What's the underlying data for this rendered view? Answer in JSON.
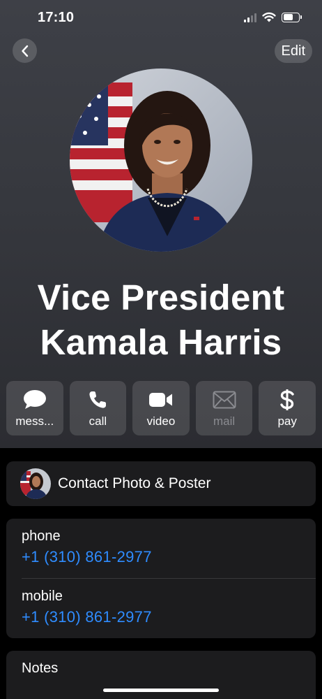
{
  "status_bar": {
    "time": "17:10",
    "battery_level": 0.65
  },
  "nav": {
    "back_icon": "chevron-left-icon",
    "edit_label": "Edit"
  },
  "contact": {
    "name_line1": "Vice President",
    "name_line2": "Kamala Harris"
  },
  "actions": [
    {
      "label": "mess...",
      "icon": "message-icon",
      "enabled": true
    },
    {
      "label": "call",
      "icon": "phone-icon",
      "enabled": true
    },
    {
      "label": "video",
      "icon": "video-icon",
      "enabled": true
    },
    {
      "label": "mail",
      "icon": "mail-icon",
      "enabled": false
    },
    {
      "label": "pay",
      "icon": "dollar-icon",
      "enabled": true
    }
  ],
  "poster": {
    "label": "Contact Photo & Poster"
  },
  "phones": [
    {
      "label": "phone",
      "value": "+1 (310) 861-2977"
    },
    {
      "label": "mobile",
      "value": "+1 (310) 861-2977"
    }
  ],
  "notes": {
    "label": "Notes"
  },
  "colors": {
    "link": "#2f8cff",
    "card_bg": "#1c1c1e",
    "header_top": "#3e4047"
  }
}
